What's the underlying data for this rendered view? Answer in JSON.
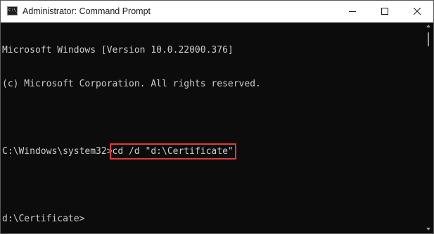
{
  "window": {
    "title": "Administrator: Command Prompt",
    "app_icon_text": "C:\\_",
    "controls": {
      "minimize": "minimize-icon",
      "maximize": "maximize-icon",
      "close": "close-icon"
    }
  },
  "terminal": {
    "lines": [
      "Microsoft Windows [Version 10.0.22000.376]",
      "(c) Microsoft Corporation. All rights reserved."
    ],
    "prompt1": "C:\\Windows\\system32>",
    "command": "cd /d \"d:\\Certificate\"",
    "prompt2": "d:\\Certificate>"
  },
  "colors": {
    "terminal_bg": "#0c0c0c",
    "terminal_text": "#cccccc",
    "highlight_box": "#e0393a",
    "titlebar_bg": "#ffffff"
  }
}
